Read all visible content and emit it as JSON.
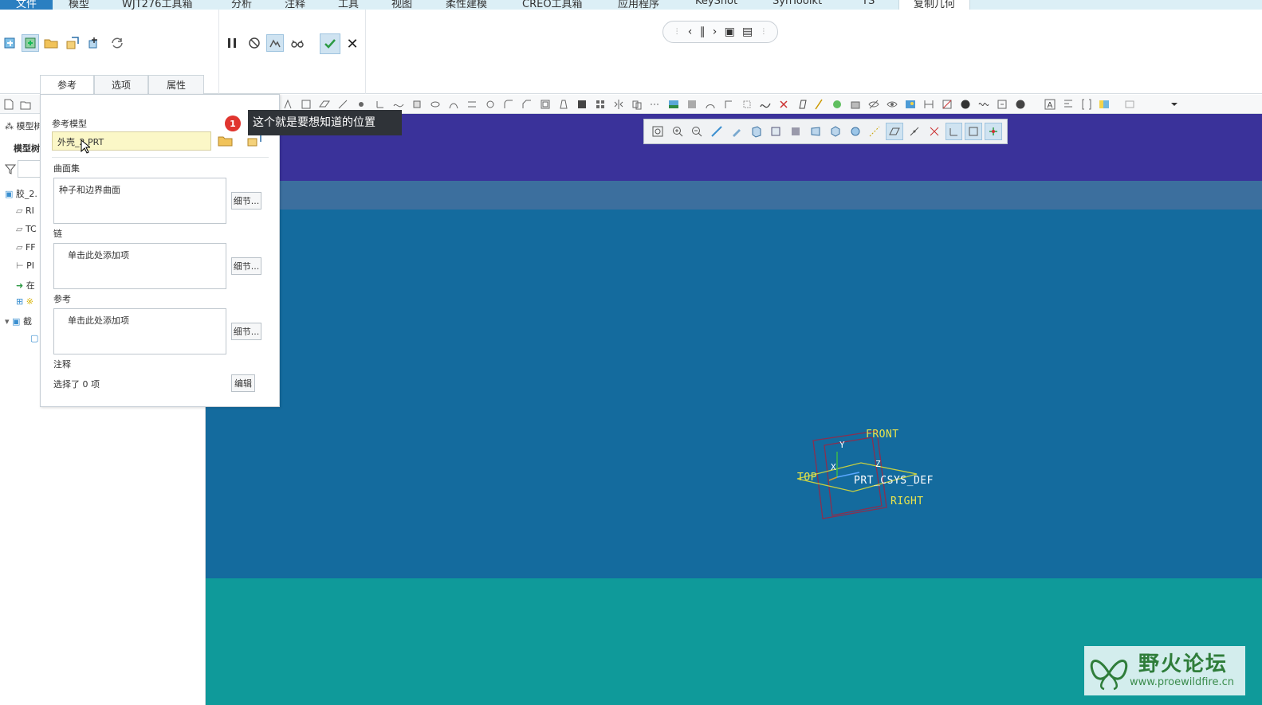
{
  "ribbon_tabs": [
    "文件",
    "模型",
    "WJT276工具箱",
    "分析",
    "注释",
    "工具",
    "视图",
    "柔性建模",
    "CREO工具箱",
    "应用程序",
    "KeyShot",
    "SynToolkt",
    "YS",
    "复制几何"
  ],
  "dashboard": {
    "subtabs": [
      "参考",
      "选项",
      "属性"
    ],
    "active_subtab": "参考"
  },
  "reference_panel": {
    "model_label": "参考模型",
    "model_value": "外壳_2.PRT",
    "surface_set_label": "曲面集",
    "surface_set_value": "种子和边界曲面",
    "chain_label": "链",
    "chain_placeholder": "单击此处添加项",
    "ref_label": "参考",
    "ref_placeholder": "单击此处添加项",
    "details_button": "细节...",
    "notes_label": "注释",
    "selected_count_text": "选择了 0 项",
    "edit_button": "编辑"
  },
  "callout": {
    "badge": "1",
    "text": "这个就是要想知道的位置"
  },
  "model_tree": {
    "header_short": "模型树",
    "header_label": "模型树",
    "rows": [
      "胶_2.",
      "RI",
      "TC",
      "FF",
      "PI",
      "在",
      "※",
      "截"
    ]
  },
  "datums": {
    "front": "FRONT",
    "top": "TOP",
    "right": "RIGHT",
    "csys": "PRT_CSYS_DEF",
    "axis_x": "X",
    "axis_y": "Y",
    "axis_z": "Z"
  },
  "colors": {
    "viewport_bg": "#146b9e",
    "viewport_top_band": "#3a329a",
    "viewport_bottom_band": "#0f9a9a",
    "datum_label": "#e9e44c",
    "ok_check": "#2e9a44",
    "callout_badge": "#e0352f"
  },
  "watermark": {
    "title": "野火论坛",
    "url": "www.proewildfire.cn"
  }
}
